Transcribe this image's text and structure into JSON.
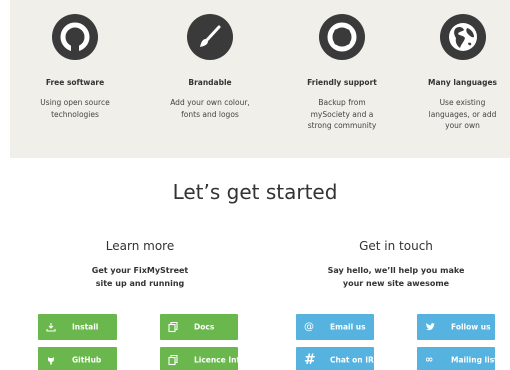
{
  "features": [
    {
      "icon": "open-source-icon",
      "title": "Free software",
      "desc": [
        "Using open source",
        "technologies"
      ]
    },
    {
      "icon": "paintbrush-icon",
      "title": "Brandable",
      "desc": [
        "Add your own colour,",
        "fonts and logos"
      ]
    },
    {
      "icon": "lifebuoy-icon",
      "title": "Friendly support",
      "desc": [
        "Backup from",
        "mySociety and a",
        "strong community"
      ]
    },
    {
      "icon": "globe-icon",
      "title": "Many languages",
      "desc": [
        "Use existing",
        "languages, or add",
        "your own"
      ]
    }
  ],
  "main_heading": "Let’s get started",
  "learn": {
    "title": "Learn more",
    "subtitle": [
      "Get your FixMyStreet",
      "site up and running"
    ],
    "buttons": {
      "install": "Install",
      "docs": "Docs",
      "github": "GitHub",
      "licence": "Licence Info"
    }
  },
  "touch": {
    "title": "Get in touch",
    "subtitle": [
      "Say hello, we’ll help you make",
      "your new site awesome"
    ],
    "buttons": {
      "email": "Email us",
      "twitter": "Follow us",
      "irc": "Chat on IRC",
      "mailing": "Mailing list"
    }
  },
  "colors": {
    "green": "#6ab84d",
    "blue": "#56b3e0",
    "panel": "#f0efe9",
    "icon_bg": "#3a3a3a"
  }
}
